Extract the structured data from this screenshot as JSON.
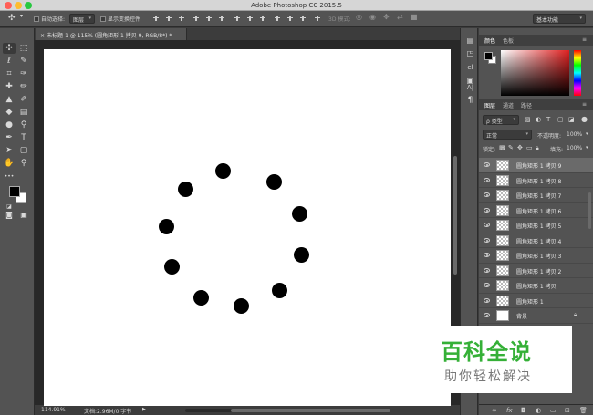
{
  "window": {
    "title": "Adobe Photoshop CC 2015.5"
  },
  "options_bar": {
    "auto_select_label": "自动选择:",
    "auto_select_value": "图层",
    "show_transform_label": "显示变换控件",
    "mode_3d_label": "3D 模式:",
    "workspace_value": "基本功能"
  },
  "document": {
    "tab_label": "未标题-1 @ 115% (圆角矩形 1 拷贝 9, RGB/8*) *",
    "zoom": "114.91%",
    "doc_info": "文档:2.96M/0 字节",
    "canvas_color": "#ffffff",
    "dot_color": "#000000",
    "dot_count": 10
  },
  "color_panel": {
    "tabs": [
      "颜色",
      "色板"
    ],
    "hue_color": "#e02020",
    "foreground": "#000000",
    "background": "#ffffff"
  },
  "layers_panel": {
    "tabs": [
      "图层",
      "通道",
      "路径"
    ],
    "filter_label": "ρ 类型",
    "blend_mode": "正常",
    "opacity_label": "不透明度:",
    "opacity_value": "100%",
    "lock_label": "锁定:",
    "fill_label": "填充:",
    "fill_value": "100%",
    "layers": [
      {
        "name": "圆角矩形 1 拷贝 9",
        "selected": true
      },
      {
        "name": "圆角矩形 1 拷贝 8",
        "selected": false
      },
      {
        "name": "圆角矩形 1 拷贝 7",
        "selected": false
      },
      {
        "name": "圆角矩形 1 拷贝 6",
        "selected": false
      },
      {
        "name": "圆角矩形 1 拷贝 5",
        "selected": false
      },
      {
        "name": "圆角矩形 1 拷贝 4",
        "selected": false
      },
      {
        "name": "圆角矩形 1 拷贝 3",
        "selected": false
      },
      {
        "name": "圆角矩形 1 拷贝 2",
        "selected": false
      },
      {
        "name": "圆角矩形 1 拷贝",
        "selected": false
      },
      {
        "name": "圆角矩形 1",
        "selected": false
      },
      {
        "name": "背景",
        "selected": false,
        "locked": true
      }
    ],
    "footer_icons": [
      "link-icon",
      "fx-icon",
      "mask-icon",
      "adjustment-icon",
      "group-icon",
      "new-layer-icon",
      "trash-icon"
    ]
  },
  "watermark": {
    "title": "百科全说",
    "subtitle": "助你轻松解决",
    "color": "#35b037"
  }
}
